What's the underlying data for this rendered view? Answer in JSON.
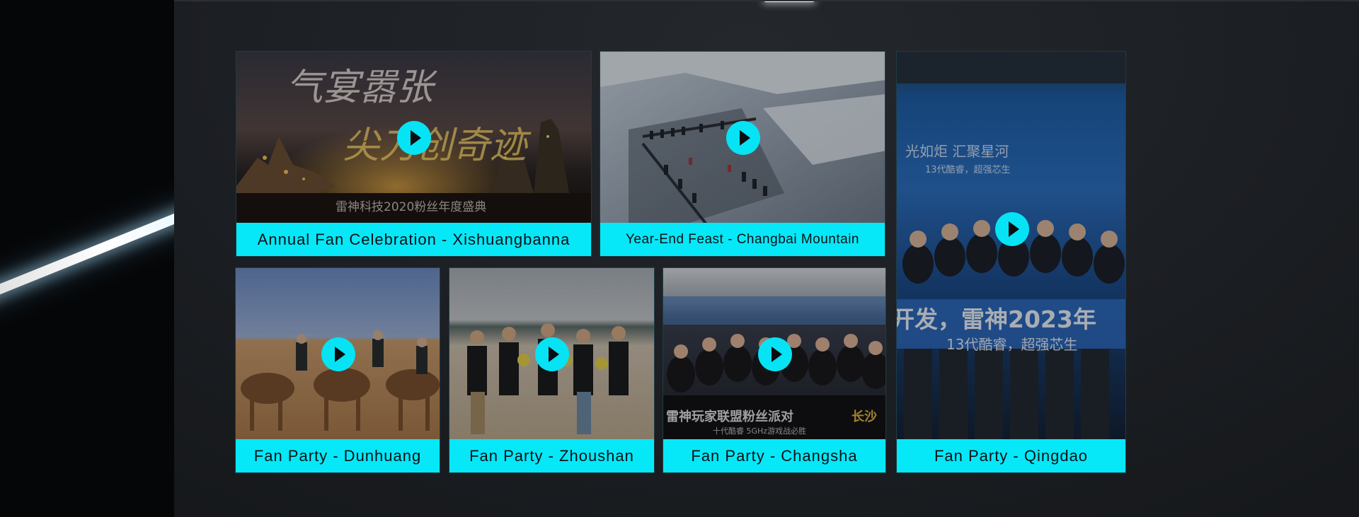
{
  "colors": {
    "accent": "#06e8f8",
    "play_button": "#06e3f4",
    "background": "#1b1e22"
  },
  "gallery": {
    "tiles": [
      {
        "caption": "Annual Fan Celebration - Xishuangbanna",
        "overlay_lines": [
          "气宴嚣张",
          "尖刀创奇迹",
          "雷神科技2020粉丝年度盛典"
        ],
        "play_icon": "play-icon"
      },
      {
        "caption": "Year-End Feast - Changbai Mountain",
        "play_icon": "play-icon"
      },
      {
        "caption": "Fan Party - Qingdao",
        "overlay_lines": [
          "光如炬  汇聚星河",
          "13代酷睿，超强芯生",
          "开发，雷神2023年",
          "13代酷睿，超强芯生"
        ],
        "play_icon": "play-icon"
      },
      {
        "caption": "Fan Party - Dunhuang",
        "play_icon": "play-icon"
      },
      {
        "caption": "Fan Party - Zhoushan",
        "play_icon": "play-icon"
      },
      {
        "caption": "Fan Party - Changsha",
        "overlay_lines": [
          "雷神玩家联盟粉丝派对",
          "长沙",
          "十代酷睿 5GHz游戏战必胜"
        ],
        "play_icon": "play-icon"
      }
    ]
  }
}
